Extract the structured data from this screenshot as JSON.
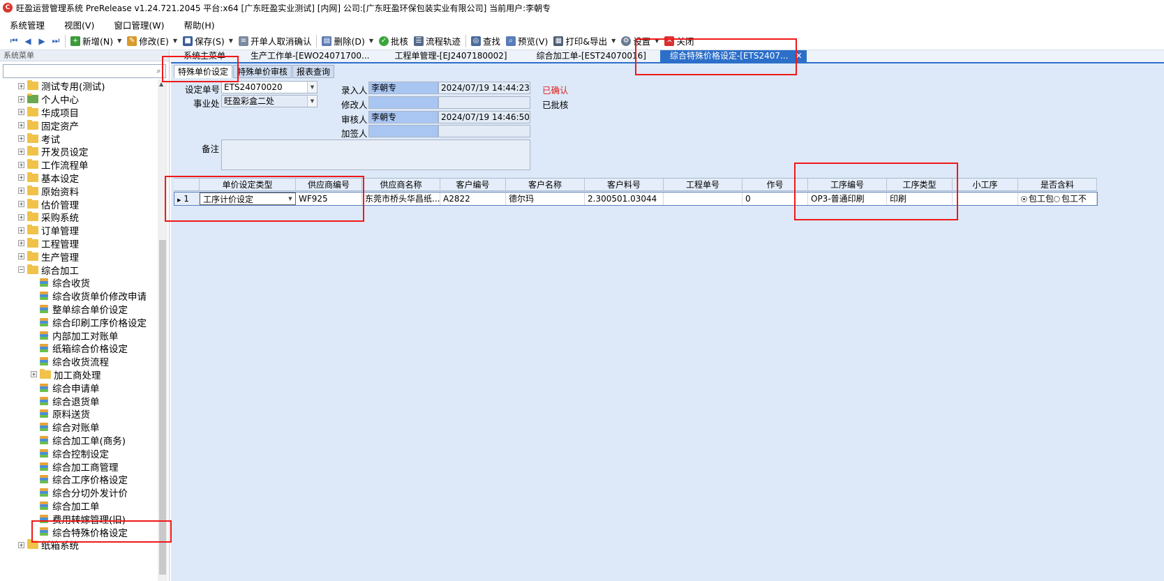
{
  "window": {
    "title": "旺盈运营管理系统 PreRelease v1.24.721.2045 平台:x64  [广东旺盈实业测试] [内网] 公司:[广东旺盈环保包装实业有限公司] 当前用户:李朝专"
  },
  "menu": [
    "系统管理",
    "视图(V)",
    "窗口管理(W)",
    "帮助(H)"
  ],
  "toolbar": {
    "new": "新增(N)",
    "edit": "修改(E)",
    "save": "保存(S)",
    "cancel_confirm": "开单人取消确认",
    "delete": "删除(D)",
    "approve": "批核",
    "flow": "流程轨迹",
    "find": "查找",
    "preview": "预览(V)",
    "print": "打印&导出",
    "settings": "设置",
    "close": "关闭"
  },
  "sidebar": {
    "header": "系统菜单",
    "items": [
      {
        "label": "测试专用(测试)",
        "kind": "folder",
        "indent": 0
      },
      {
        "label": "个人中心",
        "kind": "person",
        "indent": 0
      },
      {
        "label": "华成项目",
        "kind": "folder",
        "indent": 0
      },
      {
        "label": "固定资产",
        "kind": "folder",
        "indent": 0
      },
      {
        "label": "考试",
        "kind": "folder",
        "indent": 0
      },
      {
        "label": "开发员设定",
        "kind": "folder",
        "indent": 0
      },
      {
        "label": "工作流程单",
        "kind": "folder",
        "indent": 0
      },
      {
        "label": "基本设定",
        "kind": "folder",
        "indent": 0
      },
      {
        "label": "原始资料",
        "kind": "folder",
        "indent": 0
      },
      {
        "label": "估价管理",
        "kind": "folder",
        "indent": 0
      },
      {
        "label": "采购系统",
        "kind": "folder",
        "indent": 0
      },
      {
        "label": "订单管理",
        "kind": "folder",
        "indent": 0
      },
      {
        "label": "工程管理",
        "kind": "folder",
        "indent": 0
      },
      {
        "label": "生产管理",
        "kind": "folder",
        "indent": 0
      },
      {
        "label": "综合加工",
        "kind": "folder-open",
        "indent": 0
      },
      {
        "label": "综合收货",
        "kind": "leaf",
        "indent": 1
      },
      {
        "label": "综合收货单价修改申请",
        "kind": "leaf",
        "indent": 1
      },
      {
        "label": "整单综合单价设定",
        "kind": "leaf",
        "indent": 1
      },
      {
        "label": "综合印刷工序价格设定",
        "kind": "leaf",
        "indent": 1
      },
      {
        "label": "内部加工对账单",
        "kind": "leaf",
        "indent": 1
      },
      {
        "label": "纸箱综合价格设定",
        "kind": "leaf",
        "indent": 1
      },
      {
        "label": "综合收货流程",
        "kind": "leaf",
        "indent": 1
      },
      {
        "label": "加工商处理",
        "kind": "folder",
        "indent": 1
      },
      {
        "label": "综合申请单",
        "kind": "leaf",
        "indent": 1
      },
      {
        "label": "综合退货单",
        "kind": "leaf",
        "indent": 1
      },
      {
        "label": "原料送货",
        "kind": "leaf",
        "indent": 1
      },
      {
        "label": "综合对账单",
        "kind": "leaf",
        "indent": 1
      },
      {
        "label": "综合加工单(商务)",
        "kind": "leaf",
        "indent": 1
      },
      {
        "label": "综合控制设定",
        "kind": "leaf",
        "indent": 1
      },
      {
        "label": "综合加工商管理",
        "kind": "leaf",
        "indent": 1
      },
      {
        "label": "综合工序价格设定",
        "kind": "leaf",
        "indent": 1
      },
      {
        "label": "综合分切外发计价",
        "kind": "leaf",
        "indent": 1
      },
      {
        "label": "综合加工单",
        "kind": "leaf",
        "indent": 1
      },
      {
        "label": "费用转嫁管理(旧)",
        "kind": "leaf",
        "indent": 1
      },
      {
        "label": "综合特殊价格设定",
        "kind": "leaf",
        "indent": 1
      },
      {
        "label": "纸箱系统",
        "kind": "folder",
        "indent": 0
      }
    ]
  },
  "doc_tabs": [
    "系统主菜单",
    "生产工作单-[EWO24071700...",
    "工程单管理-[EJ2407180002]",
    "综合加工单-[EST24070016]",
    "综合特殊价格设定-[ETS2407..."
  ],
  "sub_tabs": [
    "特殊单价设定",
    "特殊单价审核",
    "报表查询"
  ],
  "form": {
    "doc_no_label": "设定单号",
    "doc_no": "ETS24070020",
    "dept_label": "事业处",
    "dept": "旺盈彩盒二处",
    "entered_by_label": "录入人",
    "entered_by": "李朝专",
    "entered_time": "2024/07/19 14:44:23",
    "modified_by_label": "修改人",
    "modified_by": "",
    "modified_time": "",
    "reviewer_label": "审核人",
    "reviewer": "李朝专",
    "review_time": "2024/07/19 14:46:50",
    "cosigner_label": "加签人",
    "cosigner": "",
    "cosign_time": "",
    "status_confirmed": "已确认",
    "status_approved": "已批核",
    "remark_label": "备注",
    "remark": ""
  },
  "grid": {
    "columns": [
      "单价设定类型",
      "供应商编号",
      "供应商名称",
      "客户编号",
      "客户名称",
      "客户料号",
      "工程单号",
      "作号",
      "工序编号",
      "工序类型",
      "小工序",
      "是否含料"
    ],
    "rows": [
      {
        "row_no": "1",
        "price_type": "工序计价设定",
        "supplier_no": "WF925",
        "supplier_name": "东莞市桥头华昌纸...",
        "customer_no": "A2822",
        "customer_name": "德尔玛",
        "customer_part": "2.300501.03044",
        "project_no": "",
        "job_no": "0",
        "process_no": "OP3-普通印刷",
        "process_type": "印刷",
        "sub_process": "",
        "material_opt1": "包工包",
        "material_opt2": "包工不"
      }
    ]
  },
  "colors": {
    "accent": "#2c6fc9",
    "highlight": "#f01818",
    "status_confirmed": "#e02020"
  }
}
